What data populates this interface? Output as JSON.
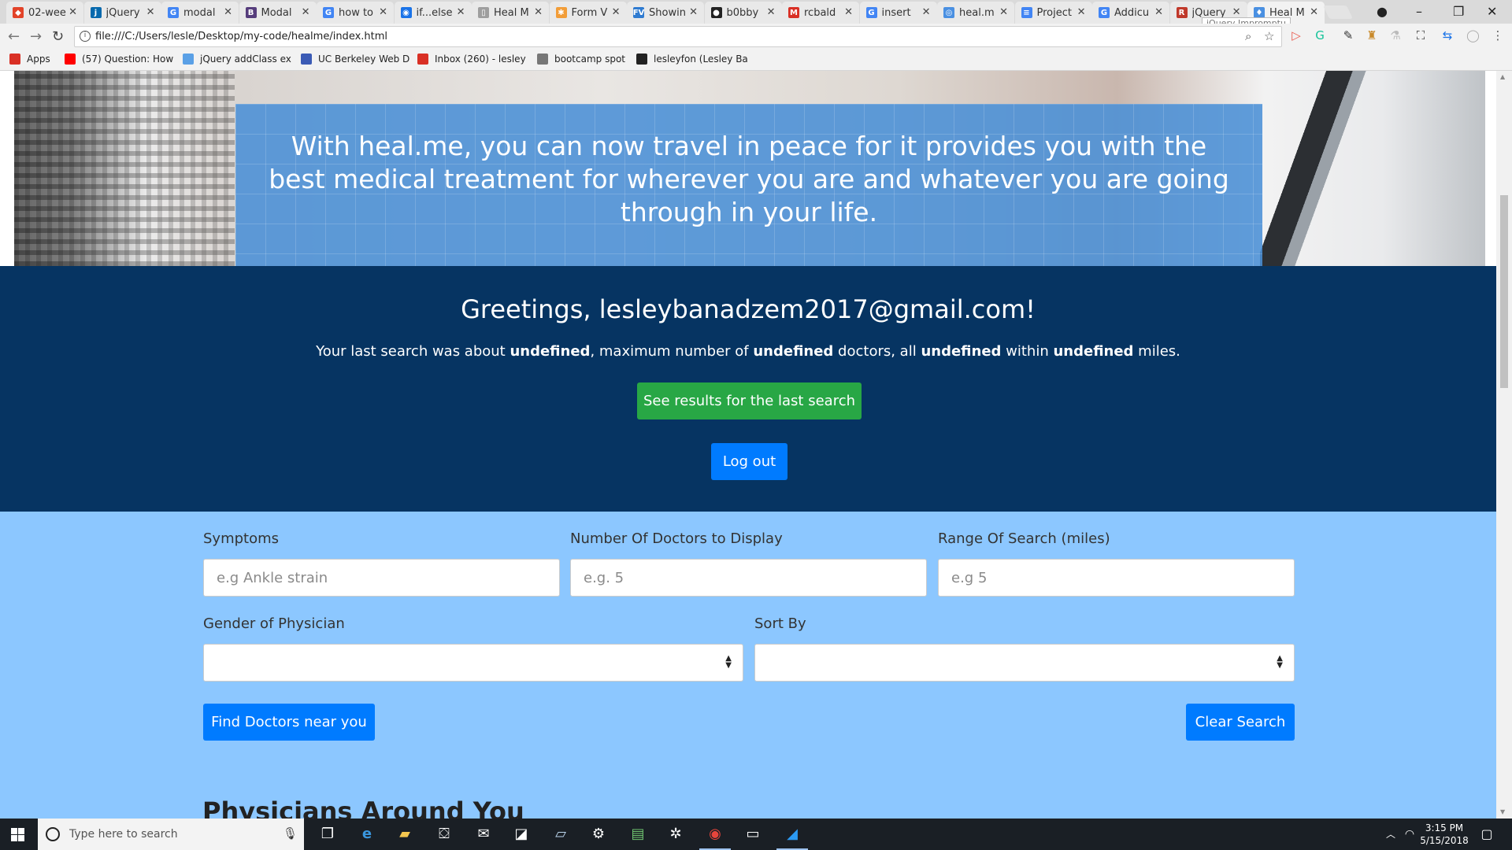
{
  "browser": {
    "tabs": [
      {
        "title": "02-wee",
        "color": "#e24329",
        "glyph": "◆"
      },
      {
        "title": "jQuery",
        "color": "#0769ad",
        "glyph": "j"
      },
      {
        "title": "modal",
        "color": "#4285f4",
        "glyph": "G"
      },
      {
        "title": "Modal",
        "color": "#563d7c",
        "glyph": "B"
      },
      {
        "title": "how to",
        "color": "#4285f4",
        "glyph": "G"
      },
      {
        "title": "if...else",
        "color": "#1a73e8",
        "glyph": "◉"
      },
      {
        "title": "Heal M",
        "color": "#9e9e9e",
        "glyph": "▯"
      },
      {
        "title": "Form V",
        "color": "#f29d38",
        "glyph": "✱"
      },
      {
        "title": "Showin",
        "color": "#2f7bd1",
        "glyph": "FV"
      },
      {
        "title": "b0bby",
        "color": "#222222",
        "glyph": "●"
      },
      {
        "title": "rcbald",
        "color": "#d93025",
        "glyph": "M"
      },
      {
        "title": "insert",
        "color": "#4285f4",
        "glyph": "G"
      },
      {
        "title": "heal.m",
        "color": "#4a90e2",
        "glyph": "◎"
      },
      {
        "title": "Project",
        "color": "#4285f4",
        "glyph": "≡"
      },
      {
        "title": "Addicu",
        "color": "#4285f4",
        "glyph": "G"
      },
      {
        "title": "jQuery",
        "color": "#c0392b",
        "glyph": "R"
      },
      {
        "title": "Heal M",
        "color": "#4a90e2",
        "glyph": "♦"
      }
    ],
    "active_tab": 16,
    "tooltip": "jQuery Impromptu",
    "url": "file:///C:/Users/lesle/Desktop/my-code/healme/index.html",
    "bookmarks": [
      {
        "label": "Apps",
        "icon": "apps-grid-icon",
        "color": "#d93025"
      },
      {
        "label": "(57) Question: How",
        "icon": "youtube-icon",
        "color": "#ff0000"
      },
      {
        "label": "jQuery addClass ex",
        "icon": "cloud-icon",
        "color": "#5aa0e6"
      },
      {
        "label": "UC Berkeley Web D",
        "icon": "doc-icon",
        "color": "#3b5bb5"
      },
      {
        "label": "Inbox (260) - lesley",
        "icon": "gmail-icon",
        "color": "#d93025"
      },
      {
        "label": "bootcamp spot",
        "icon": "page-icon",
        "color": "#777777"
      },
      {
        "label": "lesleyfon (Lesley Ba",
        "icon": "github-icon",
        "color": "#222222"
      }
    ]
  },
  "hero": {
    "tagline": "With heal.me, you can now travel in peace for it provides you with the best medical treatment for wherever you are and whatever you are going through in your life."
  },
  "greeting": {
    "title": "Greetings, lesleybanadzem2017@gmail.com!",
    "sentence": {
      "p1": "Your last search was about ",
      "v1": "undefined",
      "p2": ", maximum number of ",
      "v2": "undefined",
      "p3": " doctors, all ",
      "v3": "undefined",
      "p4": " within ",
      "v4": "undefined",
      "p5": " miles."
    },
    "last_search_button": "See results for the last search",
    "logout_button": "Log out"
  },
  "search": {
    "symptoms_label": "Symptoms",
    "symptoms_placeholder": "e.g Ankle strain",
    "doctors_label": "Number Of Doctors to Display",
    "doctors_placeholder": "e.g. 5",
    "range_label": "Range Of Search (miles)",
    "range_placeholder": "e.g 5",
    "gender_label": "Gender of Physician",
    "gender_value": "",
    "sort_label": "Sort By",
    "sort_value": "",
    "find_button": "Find Doctors near you",
    "clear_button": "Clear Search",
    "physicians_heading": "Physicians Around You"
  },
  "taskbar": {
    "search_placeholder": "Type here to search",
    "time": "3:15 PM",
    "date": "5/15/2018"
  }
}
